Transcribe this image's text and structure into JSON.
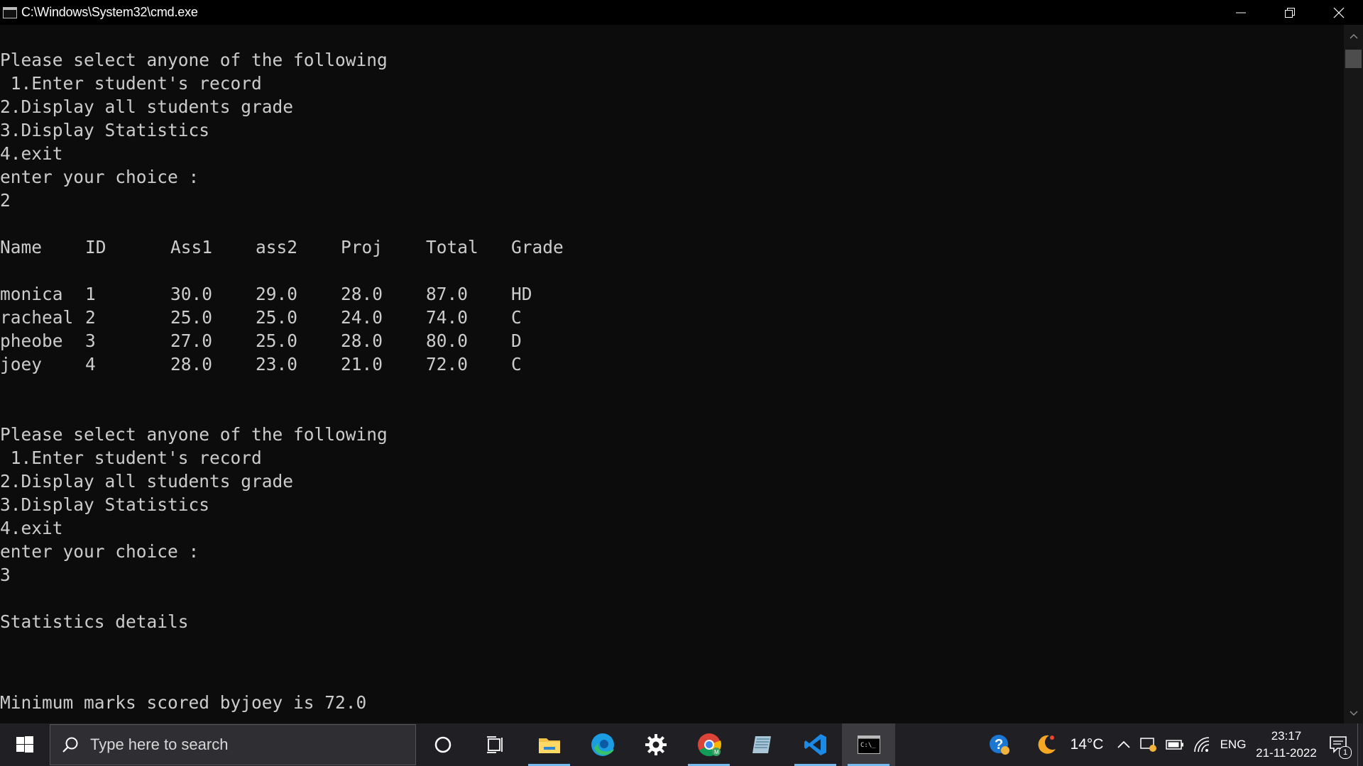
{
  "window": {
    "title": "C:\\Windows\\System32\\cmd.exe"
  },
  "console": {
    "menu1": [
      "Please select anyone of the following",
      " 1.Enter student's record",
      "2.Display all students grade",
      "3.Display Statistics",
      "4.exit",
      "enter your choice :",
      "2"
    ],
    "table": {
      "headers": [
        "Name",
        "ID",
        "Ass1",
        "ass2",
        "Proj",
        "Total",
        "Grade"
      ],
      "rows": [
        [
          "monica",
          "1",
          "30.0",
          "29.0",
          "28.0",
          "87.0",
          "HD"
        ],
        [
          "racheal",
          "2",
          "25.0",
          "25.0",
          "24.0",
          "74.0",
          "C"
        ],
        [
          "pheobe",
          "3",
          "27.0",
          "25.0",
          "28.0",
          "80.0",
          "D"
        ],
        [
          "joey",
          "4",
          "28.0",
          "23.0",
          "21.0",
          "72.0",
          "C"
        ]
      ]
    },
    "menu2": [
      "Please select anyone of the following",
      " 1.Enter student's record",
      "2.Display all students grade",
      "3.Display Statistics",
      "4.exit",
      "enter your choice :",
      "3"
    ],
    "stats_heading": "Statistics details",
    "min_line": "Minimum marks scored byjoey is 72.0"
  },
  "taskbar": {
    "search_placeholder": "Type here to search",
    "icons": [
      "windows-start-icon",
      "cortana-icon",
      "task-view-icon",
      "file-explorer-icon",
      "edge-icon",
      "settings-icon",
      "chrome-icon",
      "notepad-icon",
      "vscode-icon",
      "cmd-icon"
    ],
    "weather_temp": "14°C",
    "language": "ENG",
    "time": "23:17",
    "date": "21-11-2022",
    "notification_count": "1"
  },
  "colors": {
    "console_bg": "#0c0c0c",
    "console_fg": "#cccccc",
    "taskbar_bg": "#1f1f24",
    "accent": "#76b9ed"
  }
}
